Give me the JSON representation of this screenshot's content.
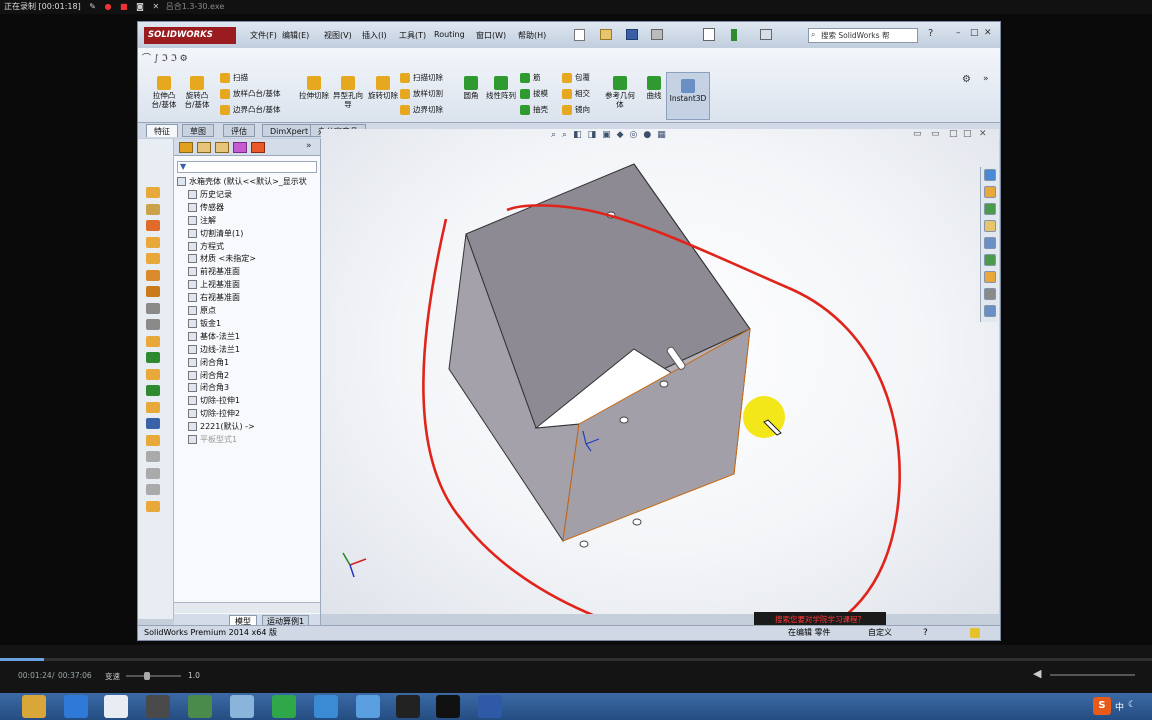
{
  "recorder": {
    "status": "正在录制 [00:01:18]",
    "file": "吕合1.3-30.exe"
  },
  "window": {
    "app_name": "SOLIDWORKS",
    "menus": [
      "文件(F)",
      "编辑(E)",
      "视图(V)",
      "插入(I)",
      "工具(T)",
      "Routing",
      "窗口(W)",
      "帮助(H)"
    ],
    "search_placeholder": "搜索 SolidWorks 帮",
    "ribbon": {
      "big_buttons": [
        {
          "label": "拉伸凸台/基体",
          "color": "#e6a81e"
        },
        {
          "label": "旋转凸台/基体",
          "color": "#e6a81e"
        },
        {
          "label": "拉伸切除",
          "color": "#e6a81e"
        },
        {
          "label": "异型孔向导",
          "color": "#e6a81e"
        },
        {
          "label": "旋转切除",
          "color": "#e6a81e"
        },
        {
          "label": "圆角",
          "color": "#2f9a2f"
        },
        {
          "label": "线性阵列",
          "color": "#2f9a2f"
        },
        {
          "label": "参考几何体",
          "color": "#2f9a2f"
        },
        {
          "label": "曲线",
          "color": "#2f9a2f"
        }
      ],
      "small_buttons": [
        "扫描",
        "放样凸台/基体",
        "边界凸台/基体",
        "扫描切除",
        "放样切割",
        "边界切除",
        "筋",
        "拔模",
        "抽壳",
        "包覆",
        "相交",
        "镜向"
      ],
      "instant3d": "Instant3D"
    },
    "tabs": [
      "特征",
      "草图",
      "评估",
      "DimXpert",
      "办公室产品"
    ],
    "tree_items": [
      "水箱壳体 (默认<<默认>_显示状",
      "历史记录",
      "传感器",
      "注解",
      "切割清单(1)",
      "方程式",
      "材质 <未指定>",
      "前视基准面",
      "上视基准面",
      "右视基准面",
      "原点",
      "钣金1",
      "基体-法兰1",
      "边线-法兰1",
      "闭合角1",
      "闭合角2",
      "闭合角3",
      "切除-拉伸1",
      "切除-拉伸2",
      "2221(默认) ->",
      "平板型式1"
    ],
    "bottom_tabs": [
      "模型",
      "运动算例1"
    ],
    "status_left": "SolidWorks Premium 2014 x64 版",
    "status_mid": "在编辑 零件",
    "status_right": "自定义",
    "hint": "搜索您要对学院学习课程？"
  },
  "player": {
    "time_current": "00:01:24",
    "time_total": "00:37:06",
    "speed_label": "变速",
    "speed_value": "1.0"
  },
  "taskbar": {
    "ime": "中"
  },
  "colors": {
    "annotation_red": "#e0241b",
    "box_face": "#9a97a0",
    "box_inner": "#8b8892",
    "highlight": "#f2e400"
  }
}
